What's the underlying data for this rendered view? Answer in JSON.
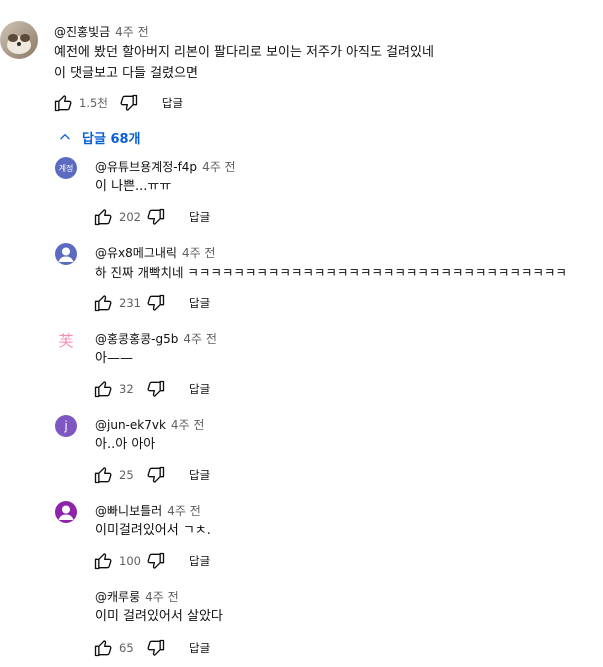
{
  "main_comment": {
    "author": "@진홍빛금",
    "time": "4주 전",
    "lines": [
      "예전에 봤던 할아버지 리본이 팔다리로 보이는 저주가 아직도 걸려있네",
      "이 댓글보고 다들 걸렸으면"
    ],
    "likes": "1.5천",
    "reply_label": "답글"
  },
  "replies_toggle": {
    "label": "답글 68개"
  },
  "replies": [
    {
      "author": "@유튜브용계정-f4p",
      "time": "4주 전",
      "text": "이 나쁜...ㅠㅠ",
      "likes": "202",
      "reply_label": "답글",
      "avatar_text": "계정",
      "avatar_color": "#5c6bc0"
    },
    {
      "author": "@유x8메그내릭",
      "time": "4주 전",
      "text": "하 진짜 개빡치네 ㅋㅋㅋㅋㅋㅋㅋㅋㅋㅋㅋㅋㅋㅋㅋㅋㅋㅋㅋㅋㅋㅋㅋㅋㅋㅋㅋㅋㅋㅋㅋㅋㅋ",
      "likes": "231",
      "reply_label": "답글",
      "avatar_color": "#5c6bc0"
    },
    {
      "author": "@홍콩홍콩-g5b",
      "time": "4주 전",
      "text": "아——",
      "likes": "32",
      "reply_label": "답글",
      "avatar_text": "芙",
      "avatar_color": "#f8bbd0"
    },
    {
      "author": "@jun-ek7vk",
      "time": "4주 전",
      "text": "아..아 아아",
      "likes": "25",
      "reply_label": "답글",
      "avatar_text": "j",
      "avatar_color": "#7e57c2"
    },
    {
      "author": "@빠니보틀러",
      "time": "4주 전",
      "text": "이미걸려있어서 ㄱㅊ.",
      "likes": "100",
      "reply_label": "답글",
      "avatar_color": "#8e24aa"
    },
    {
      "author": "@캐루룽",
      "time": "4주 전",
      "text": "이미 걸려있어서 살았다",
      "likes": "65",
      "reply_label": "답글"
    }
  ]
}
